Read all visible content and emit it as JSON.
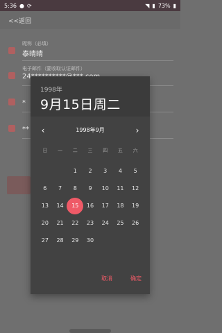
{
  "status_bar": {
    "time": "5:36",
    "battery": "73%"
  },
  "background": {
    "header_title": "<<返回",
    "rows": [
      {
        "hint": "昵称（必填）",
        "value": "泰晴晴"
      },
      {
        "hint": "电子邮件（要收取认证邮件）",
        "value": "24**********@***.com"
      },
      {
        "hint": "",
        "value": "*"
      },
      {
        "hint": "",
        "value": "** "
      }
    ]
  },
  "dialog": {
    "year": "1998年",
    "date": "9月15日周二",
    "month_label": "1998年9月",
    "weekdays": [
      "日",
      "一",
      "二",
      "三",
      "四",
      "五",
      "六"
    ],
    "days": [
      "",
      "",
      "1",
      "2",
      "3",
      "4",
      "5",
      "6",
      "7",
      "8",
      "9",
      "10",
      "11",
      "12",
      "13",
      "14",
      "15",
      "16",
      "17",
      "18",
      "19",
      "20",
      "21",
      "22",
      "23",
      "24",
      "25",
      "26",
      "27",
      "28",
      "29",
      "30",
      "",
      "",
      ""
    ],
    "selected_day": "15",
    "cancel_label": "取消",
    "ok_label": "确定"
  }
}
